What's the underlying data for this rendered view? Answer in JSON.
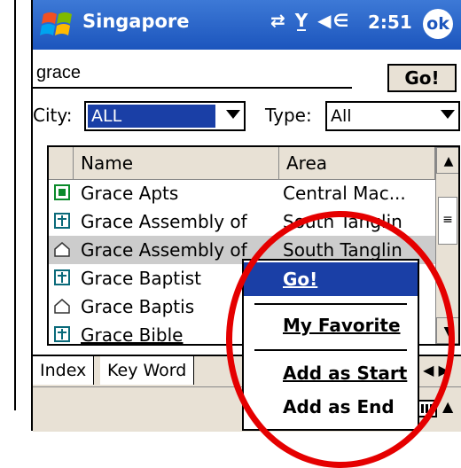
{
  "titlebar": {
    "title": "Singapore",
    "status_icons": "⇄ Y̲ ◀∈",
    "time": "2:51",
    "ok_label": "ok"
  },
  "search": {
    "value": "grace",
    "go_label": "Go!"
  },
  "filters": {
    "city_label": "City:",
    "city_value": "ALL",
    "type_label": "Type:",
    "type_value": "All"
  },
  "table": {
    "columns": [
      "Name",
      "Area"
    ],
    "rows": [
      {
        "name": "Grace Apts",
        "area": "Central Mac...",
        "icon": "building-icon"
      },
      {
        "name": "Grace Assembly of",
        "area": "South Tanglin",
        "icon": "cross-icon"
      },
      {
        "name": "Grace Assembly of",
        "area": "South Tanglin",
        "icon": "house-icon"
      },
      {
        "name": "Grace Baptist",
        "area": "...",
        "icon": "cross-icon"
      },
      {
        "name": "Grace Baptis",
        "area": "...",
        "icon": "house-icon"
      },
      {
        "name": "Grace Bible",
        "area": "",
        "icon": "cross-icon"
      }
    ]
  },
  "tabs": [
    "Index",
    "Key Word"
  ],
  "context_menu": {
    "items": [
      {
        "label": "Go!"
      },
      {
        "label": "My Favorite"
      },
      {
        "label": "Add as Start"
      },
      {
        "label": "Add as End"
      }
    ]
  },
  "colors": {
    "titlebar": "#1c55bd",
    "highlight": "#1a3fa6",
    "annotation": "#e50000"
  }
}
